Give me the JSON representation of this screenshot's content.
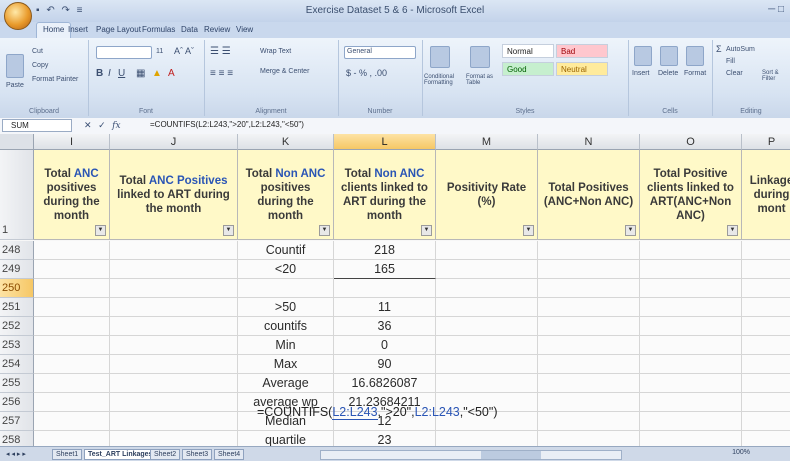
{
  "window": {
    "title": "Exercise Dataset 5 & 6 - Microsoft Excel",
    "quick_access": "▪ ↶ ↷ ≡"
  },
  "ribbon": {
    "tabs": [
      "Home",
      "Insert",
      "Page Layout",
      "Formulas",
      "Data",
      "Review",
      "View"
    ],
    "clipboard": {
      "cut": "Cut",
      "copy": "Copy",
      "paste": "Paste",
      "format_painter": "Format Painter",
      "label": "Clipboard"
    },
    "font": {
      "size": "11",
      "label": "Font"
    },
    "alignment": {
      "wrap": "Wrap Text",
      "merge": "Merge & Center",
      "label": "Alignment"
    },
    "number": {
      "format": "General",
      "label": "Number"
    },
    "styles": {
      "conditional": "Conditional Formatting",
      "format_table": "Format as Table",
      "normal": "Normal",
      "bad": "Bad",
      "good": "Good",
      "neutral": "Neutral",
      "label": "Styles"
    },
    "cells": {
      "insert": "Insert",
      "delete": "Delete",
      "format": "Format",
      "label": "Cells"
    },
    "editing": {
      "autosum": "AutoSum",
      "fill": "Fill",
      "clear": "Clear",
      "sort": "Sort & Filter",
      "label": "Editing"
    }
  },
  "formula_bar": {
    "name_box": "SUM",
    "cancel": "✕",
    "enter": "✓",
    "fx": "fx",
    "formula": "=COUNTIFS(L2:L243,\">20\",L2:L243,\"<50\")"
  },
  "grid": {
    "columns": [
      "I",
      "J",
      "K",
      "L",
      "M",
      "N",
      "O",
      "P"
    ],
    "header_row": "1",
    "headers": {
      "I": [
        "Total ",
        "ANC",
        " positives during the month"
      ],
      "J": [
        "Total ",
        "ANC",
        " Positives",
        " linked to ART during the month"
      ],
      "K": [
        "Total ",
        "Non ANC",
        " positives during the month"
      ],
      "L": [
        "Total ",
        "Non ANC",
        " clients linked to ART during the month"
      ],
      "M": [
        "Positivity Rate (%)"
      ],
      "N": [
        "Total Positives (ANC+Non ANC)"
      ],
      "O": [
        "Total Positive clients linked to ART(ANC+Non ANC)"
      ],
      "P": [
        "Linkage during mont"
      ]
    },
    "rows": [
      {
        "num": "248",
        "k": "Countif",
        "l": "218"
      },
      {
        "num": "249",
        "k": "<20",
        "l": "165"
      },
      {
        "num": "250",
        "k": "",
        "l": ""
      },
      {
        "num": "251",
        "k": ">50",
        "l": "11"
      },
      {
        "num": "252",
        "k": "countifs",
        "l": "36"
      },
      {
        "num": "253",
        "k": "Min",
        "l": "0"
      },
      {
        "num": "254",
        "k": "Max",
        "l": "90"
      },
      {
        "num": "255",
        "k": "Average",
        "l": "16.6826087"
      },
      {
        "num": "256",
        "k": "average wp",
        "l": "21.23684211"
      },
      {
        "num": "257",
        "k": "Median",
        "l": "12"
      },
      {
        "num": "258",
        "k": "quartile",
        "l": "23"
      }
    ],
    "editing_cell": {
      "prefix": "=COUNTIFS(",
      "ref1": "L2:L243",
      "mid": ",\">20\",",
      "ref2": "L2:L243",
      "suffix": ",\"<50\")"
    }
  },
  "sheets": {
    "tabs": [
      "Sheet1",
      "Test_ART Linkages",
      "Sheet2",
      "Sheet3",
      "Sheet4"
    ],
    "active": "Test_ART Linkages",
    "nav": "◂ ◂ ▸ ▸"
  },
  "status": {
    "zoom": "100%"
  }
}
